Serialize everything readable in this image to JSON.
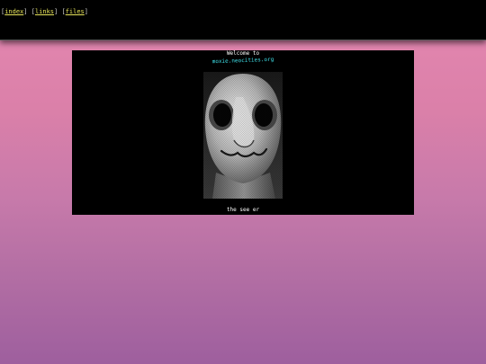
{
  "nav": {
    "items": [
      {
        "label": "index"
      },
      {
        "label": "links"
      },
      {
        "label": "files"
      }
    ]
  },
  "panel": {
    "welcome": "Welcome to",
    "site": "moxie.neocities.org",
    "caption": "the see er"
  },
  "colors": {
    "link": "#e7e45a",
    "site_text": "#3fe0e8",
    "background_top": "#e084ad",
    "background_bottom": "#9e5f9e"
  }
}
